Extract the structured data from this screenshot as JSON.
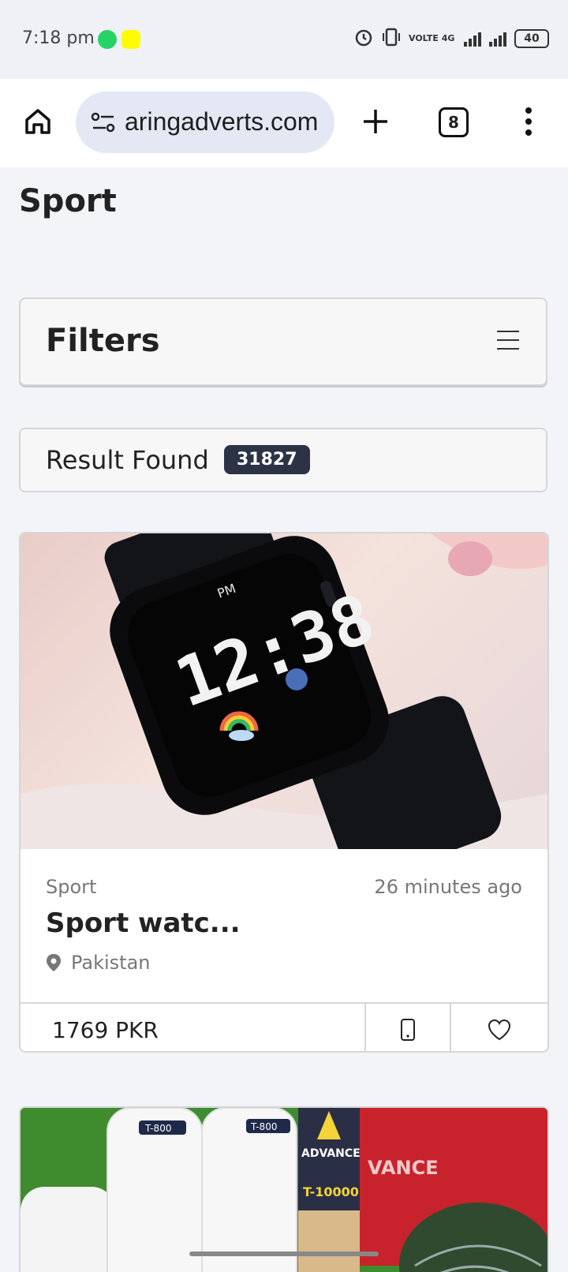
{
  "status_bar": {
    "time": "7:18 pm",
    "network_label": "VOLTE 4G",
    "battery": "40"
  },
  "browser": {
    "url": "aringadverts.com",
    "tab_count": "8"
  },
  "page": {
    "title": "Sport",
    "filters_label": "Filters",
    "result_label": "Result Found",
    "result_count": "31827"
  },
  "listings": [
    {
      "category": "Sport",
      "time": "26 minutes ago",
      "title": "Sport watc...",
      "location": "Pakistan",
      "price": "1769 PKR"
    }
  ],
  "watch_display": {
    "time": "12:38",
    "badge": "PM"
  },
  "product_labels": {
    "pad_model": "T-800",
    "bat_brand": "ADVANCE",
    "bat_model": "T-10000",
    "bag_brand": "VANCE"
  }
}
